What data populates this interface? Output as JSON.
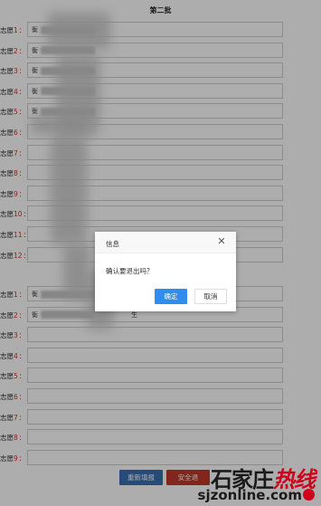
{
  "form": {
    "batch_title": "第二批",
    "group1": [
      {
        "label": "志愿",
        "num": "1",
        "value": "衡"
      },
      {
        "label": "志愿",
        "num": "2",
        "value": "衡"
      },
      {
        "label": "志愿",
        "num": "3",
        "value": "衡"
      },
      {
        "label": "志愿",
        "num": "4",
        "value": "衡"
      },
      {
        "label": "志愿",
        "num": "5",
        "value": "衡"
      },
      {
        "label": "志愿",
        "num": "6",
        "value": ""
      },
      {
        "label": "志愿",
        "num": "7",
        "value": ""
      },
      {
        "label": "志愿",
        "num": "8",
        "value": ""
      },
      {
        "label": "志愿",
        "num": "9",
        "value": ""
      },
      {
        "label": "志愿",
        "num": "10",
        "value": ""
      },
      {
        "label": "志愿",
        "num": "11",
        "value": ""
      },
      {
        "label": "志愿",
        "num": "12",
        "value": ""
      }
    ],
    "group2": [
      {
        "label": "志愿",
        "num": "1",
        "value": "衡"
      },
      {
        "label": "志愿",
        "num": "2",
        "value": "衡",
        "suffix": "生"
      },
      {
        "label": "志愿",
        "num": "3",
        "value": ""
      },
      {
        "label": "志愿",
        "num": "4",
        "value": ""
      },
      {
        "label": "志愿",
        "num": "5",
        "value": ""
      },
      {
        "label": "志愿",
        "num": "6",
        "value": ""
      },
      {
        "label": "志愿",
        "num": "7",
        "value": ""
      },
      {
        "label": "志愿",
        "num": "8",
        "value": ""
      },
      {
        "label": "志愿",
        "num": "9",
        "value": ""
      }
    ],
    "colon": "：",
    "buttons": {
      "refill": "重新填报",
      "safe_exit": "安全退"
    }
  },
  "dialog": {
    "title": "信息",
    "close_icon": "close-icon",
    "message": "确认要退出吗？",
    "confirm": "确定",
    "cancel": "取消"
  },
  "watermark": {
    "cn_dark": "石家庄",
    "cn_red": "热线",
    "en": "sjzonline.com"
  },
  "colors": {
    "label_red": "#c0392b",
    "refill_button": "#3a6fb3",
    "exit_button": "#c0392b",
    "confirm_button": "#2e8ded"
  }
}
